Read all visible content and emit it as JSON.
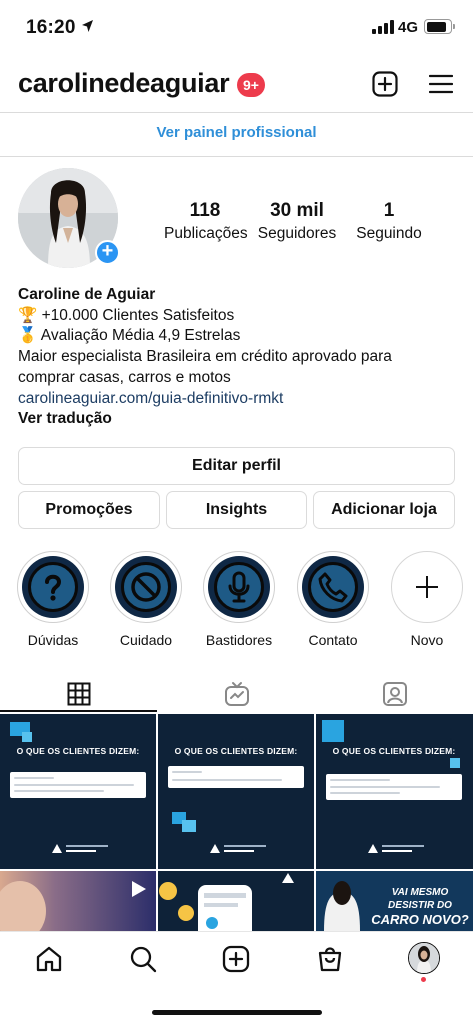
{
  "status_bar": {
    "time": "16:20",
    "network": "4G"
  },
  "header": {
    "username": "carolinedeaguiar",
    "notification_badge": "9+",
    "icons": [
      "location-arrow-icon",
      "plus-square-icon",
      "hamburger-menu-icon"
    ]
  },
  "pro_dashboard_link": "Ver painel profissional",
  "profile": {
    "stats": [
      {
        "value": "118",
        "label": "Publicações"
      },
      {
        "value": "30 mil",
        "label": "Seguidores"
      },
      {
        "value": "1",
        "label": "Seguindo"
      }
    ],
    "bio": {
      "name": "Caroline de Aguiar",
      "line1_emoji": "🏆",
      "line1_text": "+10.000 Clientes Satisfeitos",
      "line2_emoji": "🥇",
      "line2_text": "Avaliação Média 4,9 Estrelas",
      "description_line1": "Maior especialista Brasileira em crédito aprovado para",
      "description_line2": "comprar casas, carros e motos",
      "link": "carolineaguiar.com/guia-definitivo-rmkt",
      "translate": "Ver tradução"
    }
  },
  "buttons": {
    "edit_profile": "Editar perfil",
    "promotions": "Promoções",
    "insights": "Insights",
    "add_shop": "Adicionar loja"
  },
  "highlights": [
    {
      "label": "Dúvidas",
      "icon": "question-icon"
    },
    {
      "label": "Cuidado",
      "icon": "prohibited-icon"
    },
    {
      "label": "Bastidores",
      "icon": "microphone-icon"
    },
    {
      "label": "Contato",
      "icon": "phone-icon"
    },
    {
      "label": "Novo",
      "icon": "plus-icon"
    }
  ],
  "tabs": [
    "grid-icon",
    "reels-tv-icon",
    "tagged-person-icon"
  ],
  "grid_posts": [
    {
      "title": "O QUE OS CLIENTES DIZEM:"
    },
    {
      "title": "O QUE OS CLIENTES DIZEM:"
    },
    {
      "title": "O QUE OS CLIENTES DIZEM:"
    }
  ],
  "partial_posts": {
    "post6_text_line1": "VAI MESMO DESISTIR DO",
    "post6_text_line2": "CARRO NOVO?"
  },
  "colors": {
    "accent_blue": "#2f8fd8",
    "badge_red": "#ed3b4c",
    "post_navy": "#0e2238",
    "highlight_blue": "#1e5a86"
  },
  "bottom_nav": [
    "home-icon",
    "search-icon",
    "create-icon",
    "shop-icon",
    "profile-avatar"
  ]
}
